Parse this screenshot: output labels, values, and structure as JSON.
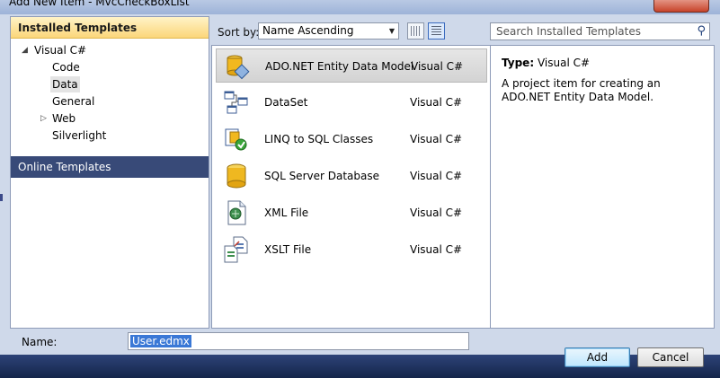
{
  "window": {
    "title": "Add New Item - MvcCheckBoxList"
  },
  "left_pane": {
    "installed_header": "Installed Templates",
    "tree": [
      {
        "label": "Visual C#",
        "expanded": true,
        "selected": false
      },
      {
        "label": "Code",
        "selected": false
      },
      {
        "label": "Data",
        "selected": true
      },
      {
        "label": "General",
        "selected": false
      },
      {
        "label": "Web",
        "expandable": true,
        "selected": false
      },
      {
        "label": "Silverlight",
        "selected": false
      }
    ],
    "online_header": "Online Templates"
  },
  "toolbar": {
    "sort_label": "Sort by:",
    "sort_value": "Name Ascending",
    "search_placeholder": "Search Installed Templates"
  },
  "templates": [
    {
      "name": "ADO.NET Entity Data Model",
      "language": "Visual C#",
      "icon": "entity-model-icon",
      "selected": true
    },
    {
      "name": "DataSet",
      "language": "Visual C#",
      "icon": "dataset-icon",
      "selected": false
    },
    {
      "name": "LINQ to SQL Classes",
      "language": "Visual C#",
      "icon": "linq-icon",
      "selected": false
    },
    {
      "name": "SQL Server Database",
      "language": "Visual C#",
      "icon": "database-icon",
      "selected": false
    },
    {
      "name": "XML File",
      "language": "Visual C#",
      "icon": "xml-file-icon",
      "selected": false
    },
    {
      "name": "XSLT File",
      "language": "Visual C#",
      "icon": "xslt-file-icon",
      "selected": false
    }
  ],
  "details": {
    "type_label": "Type:",
    "type_value": "Visual C#",
    "description": "A project item for creating an ADO.NET Entity Data Model."
  },
  "name_field": {
    "label": "Name:",
    "value": "User.edmx"
  },
  "buttons": {
    "add": "Add",
    "cancel": "Cancel"
  },
  "colors": {
    "selection_header": "#fbd67a",
    "online_header": "#384a78",
    "text_selection": "#3a78d6"
  }
}
